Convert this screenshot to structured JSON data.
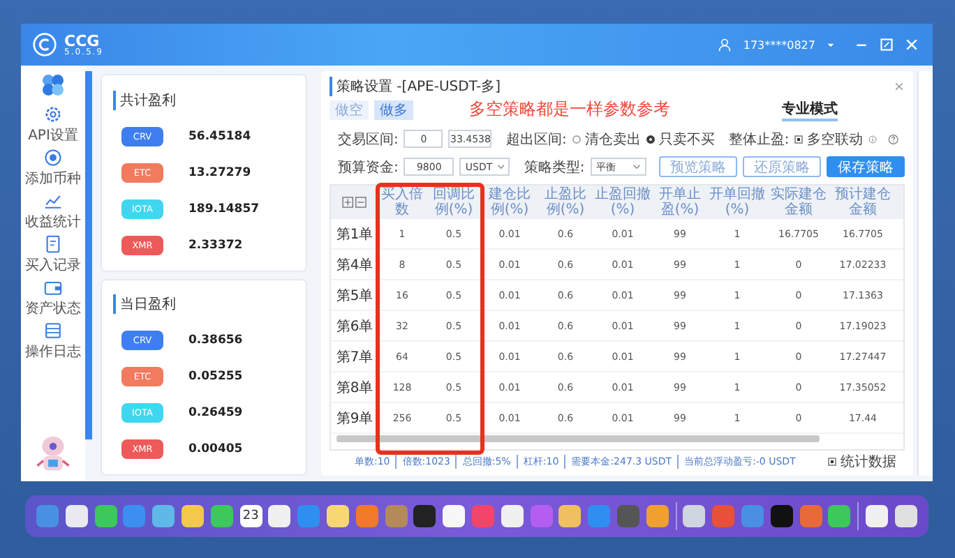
{
  "window": {
    "app_name": "CCG",
    "version": "5.0.5.9",
    "user": "173****0827"
  },
  "sidebar": {
    "items": [
      {
        "kind": "gear",
        "label": "API设置"
      },
      {
        "kind": "target",
        "label": "添加币种"
      },
      {
        "kind": "chart",
        "label": "收益统计"
      },
      {
        "kind": "doc",
        "label": "买入记录"
      },
      {
        "kind": "wallet",
        "label": "资产状态"
      },
      {
        "kind": "list",
        "label": "操作日志"
      }
    ]
  },
  "profit_cards": [
    {
      "title": "共计盈利",
      "items": [
        {
          "coin": "CRV",
          "value": "56.45184",
          "color": "#3f7ef0"
        },
        {
          "coin": "ETC",
          "value": "13.27279",
          "color": "#f27a5e"
        },
        {
          "coin": "IOTA",
          "value": "189.14857",
          "color": "#3fd6f0"
        },
        {
          "coin": "XMR",
          "value": "2.33372",
          "color": "#ee5a5a"
        }
      ]
    },
    {
      "title": "当日盈利",
      "items": [
        {
          "coin": "CRV",
          "value": "0.38656",
          "color": "#3f7ef0"
        },
        {
          "coin": "ETC",
          "value": "0.05255",
          "color": "#f27a5e"
        },
        {
          "coin": "IOTA",
          "value": "0.26459",
          "color": "#3fd6f0"
        },
        {
          "coin": "XMR",
          "value": "0.00405",
          "color": "#ee5a5a"
        }
      ]
    }
  ],
  "strategy": {
    "title": "策略设置 -[APE-USDT-多]",
    "tabs": [
      {
        "label": "做空",
        "selected": false
      },
      {
        "label": "做多",
        "selected": true
      }
    ],
    "note": "多空策略都是一样参数参考",
    "mode": "专业模式",
    "range_label": "交易区间:",
    "range_from": "0",
    "range_to": "33.4538",
    "overflow_label": "超出区间:",
    "overflow_options": [
      {
        "label": "清仓卖出",
        "selected": false
      },
      {
        "label": "只卖不买",
        "selected": true
      }
    ],
    "takeprofit_label": "整体止盈:",
    "linkage": {
      "label": "多空联动",
      "checked": true
    },
    "budget_label": "预算资金:",
    "budget": "9800",
    "currency": "USDT",
    "type_label": "策略类型:",
    "type": "平衡",
    "buttons": [
      {
        "label": "预览策略",
        "kind": "outline"
      },
      {
        "label": "还原策略",
        "kind": "outline"
      },
      {
        "label": "保存策略",
        "kind": "primary"
      }
    ]
  },
  "table": {
    "columns": [
      "",
      "买入倍数",
      "回调比例(%)",
      "建仓比例(%)",
      "止盈比例(%)",
      "止盈回撤(%)",
      "开单止盈(%)",
      "开单回撤(%)",
      "实际建仓金额",
      "预计建仓金额"
    ],
    "rows": [
      [
        "第1单",
        "1",
        "0.5",
        "0.01",
        "0.6",
        "0.01",
        "99",
        "1",
        "16.7705",
        "16.7705"
      ],
      [
        "第4单",
        "8",
        "0.5",
        "0.01",
        "0.6",
        "0.01",
        "99",
        "1",
        "0",
        "17.02233"
      ],
      [
        "第5单",
        "16",
        "0.5",
        "0.01",
        "0.6",
        "0.01",
        "99",
        "1",
        "0",
        "17.1363"
      ],
      [
        "第6单",
        "32",
        "0.5",
        "0.01",
        "0.6",
        "0.01",
        "99",
        "1",
        "0",
        "17.19023"
      ],
      [
        "第7单",
        "64",
        "0.5",
        "0.01",
        "0.6",
        "0.01",
        "99",
        "1",
        "0",
        "17.27447"
      ],
      [
        "第8单",
        "128",
        "0.5",
        "0.01",
        "0.6",
        "0.01",
        "99",
        "1",
        "0",
        "17.35052"
      ],
      [
        "第9单",
        "256",
        "0.5",
        "0.01",
        "0.6",
        "0.01",
        "99",
        "1",
        "0",
        "17.44"
      ]
    ]
  },
  "status_bar": {
    "stats": [
      "单数:10",
      "倍数:1023",
      "总回撤:5%",
      "杠杆:10",
      "需要本金:247.3 USDT",
      "当前总浮动盈亏:-0 USDT"
    ],
    "stats_toggle": {
      "label": "统计数据",
      "checked": true
    }
  },
  "dock": {
    "calendar_day": "23"
  }
}
